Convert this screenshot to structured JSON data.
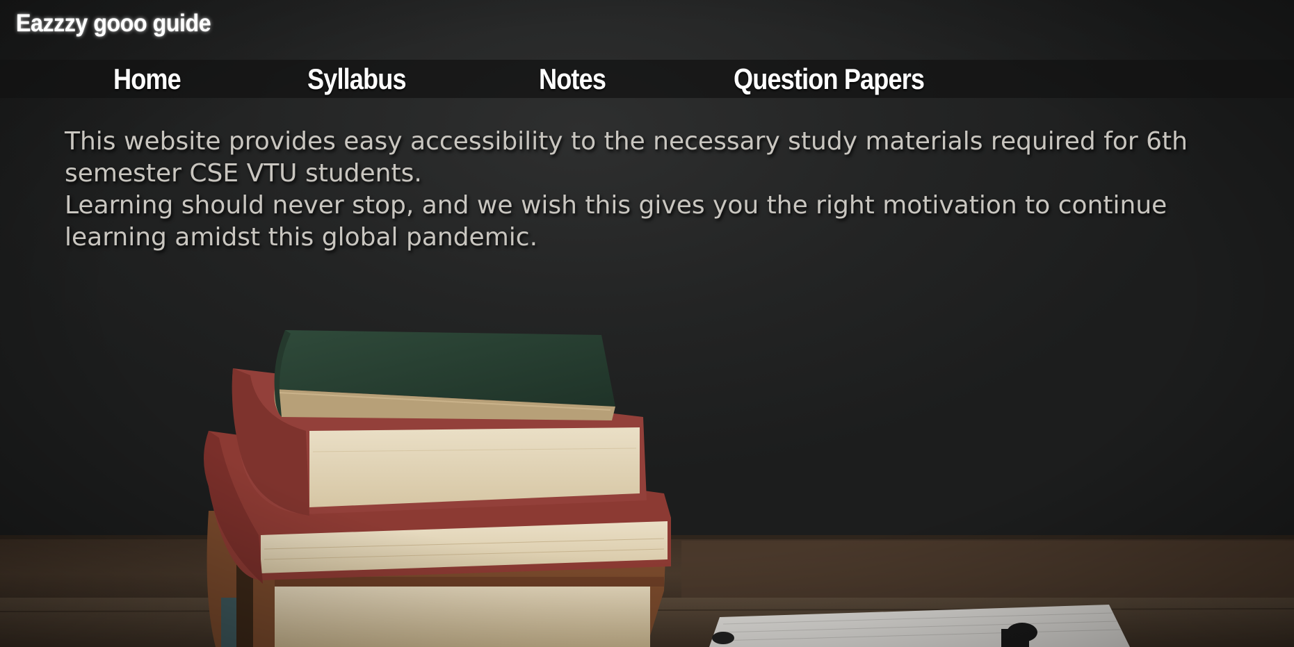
{
  "header": {
    "site_title": "Eazzzy gooo guide"
  },
  "nav": {
    "items": [
      {
        "label": "Home"
      },
      {
        "label": "Syllabus"
      },
      {
        "label": "Notes"
      },
      {
        "label": "Question Papers"
      }
    ]
  },
  "intro": {
    "line1": "This website provides easy accessibility to the necessary study materials required for 6th semester CSE VTU students.",
    "line2": "Learning should never stop, and we wish this gives you the right motivation to continue learning amidst this global pandemic."
  },
  "background": {
    "description_icon": "stacked-books-on-desk-image"
  },
  "colors": {
    "chalkboard": "#232424",
    "desk": "#3a2d22",
    "navbar": "#121212",
    "text": "#c9c6c0"
  }
}
